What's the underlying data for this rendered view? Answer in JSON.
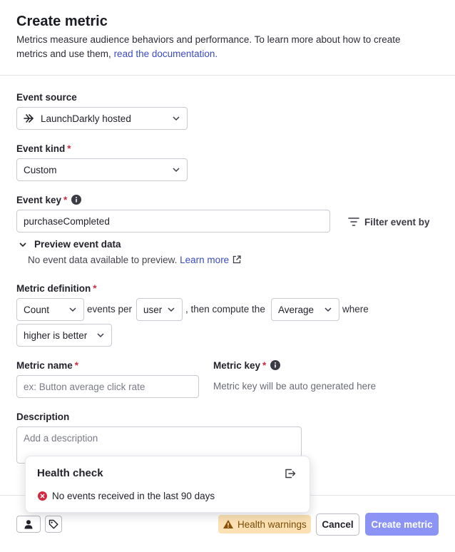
{
  "header": {
    "title": "Create metric",
    "subtitle": "Metrics measure audience behaviors and performance. To learn more about how to create metrics and use them, ",
    "doc_link": "read the documentation."
  },
  "event_source": {
    "label": "Event source",
    "value": "LaunchDarkly hosted",
    "icon": "arrow-right-icon"
  },
  "event_kind": {
    "label": "Event kind",
    "required": "*",
    "value": "Custom"
  },
  "event_key": {
    "label": "Event key",
    "required": "*",
    "value": "purchaseCompleted",
    "filter_label": "Filter event by"
  },
  "preview": {
    "toggle_label": "Preview event data",
    "empty_text": "No event data available to preview.",
    "learn_more": "Learn more"
  },
  "metric_definition": {
    "label": "Metric definition",
    "required": "*",
    "measure": "Count",
    "text_events_per": "events per",
    "unit": "user",
    "text_then_compute": ", then compute the",
    "aggregate": "Average",
    "text_where": "where",
    "success_criteria": "higher is better"
  },
  "metric_name": {
    "label": "Metric name",
    "required": "*",
    "placeholder": "ex: Button average click rate"
  },
  "metric_key": {
    "label": "Metric key",
    "required": "*",
    "note": "Metric key will be auto generated here"
  },
  "description": {
    "label": "Description",
    "placeholder": "Add a description"
  },
  "health_check": {
    "title": "Health check",
    "message": "No events received in the last 90 days"
  },
  "footer": {
    "health_warnings": "Health warnings",
    "cancel": "Cancel",
    "create": "Create metric"
  },
  "colors": {
    "primary_button": "#8b93f4",
    "link": "#3c4bc2",
    "required": "#d02a42",
    "warning_bg": "#fbe1b3",
    "warning_text": "#7c4c08",
    "error_icon": "#d02a42"
  }
}
